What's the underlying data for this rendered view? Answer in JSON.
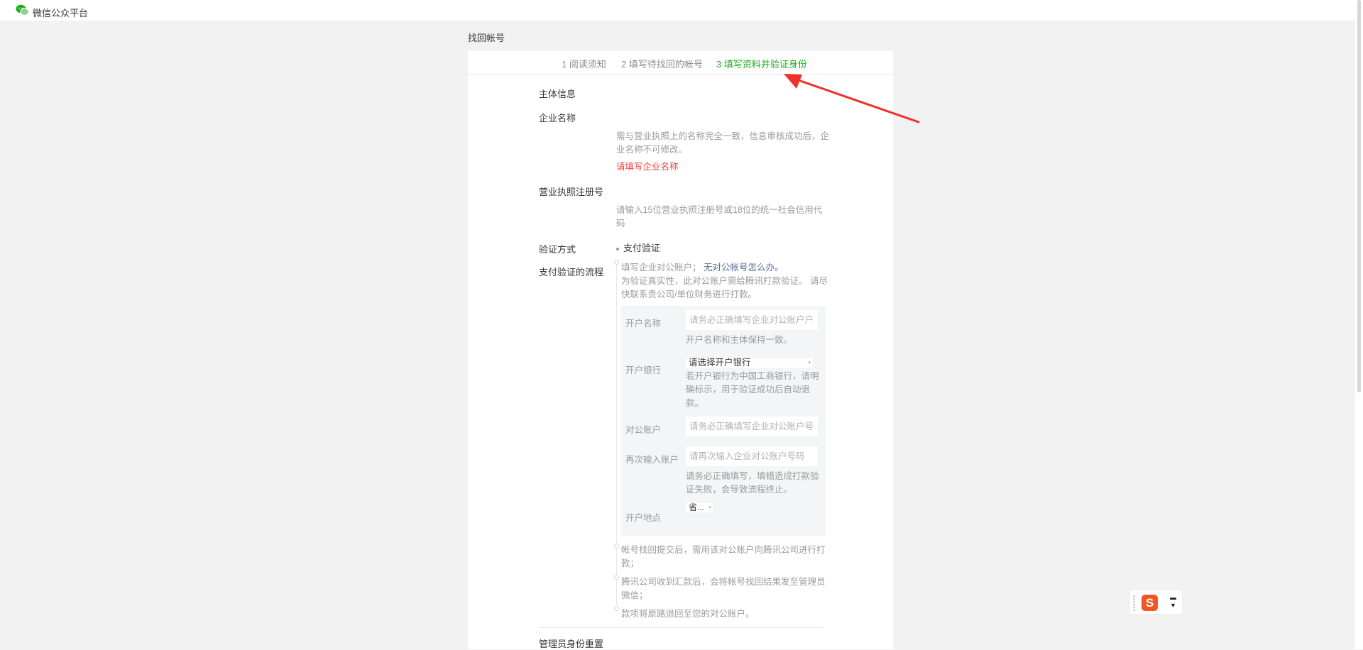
{
  "app": {
    "brand": "微信公众平台"
  },
  "page": {
    "title": "找回帐号"
  },
  "steps": [
    {
      "label": "1 阅读须知",
      "active": false
    },
    {
      "label": "2 填写待找回的帐号",
      "active": false
    },
    {
      "label": "3 填写资料并验证身份",
      "active": true
    }
  ],
  "form": {
    "section_title": "主体信息",
    "company_name": {
      "label": "企业名称",
      "help_line1": "需与营业执照上的名称完全一致，信息审核成功后，企",
      "help_line2": "业名称不可修改。",
      "error": "请填写企业名称"
    },
    "license": {
      "label": "营业执照注册号",
      "help_line1": "请输入15位营业执照注册号或18位的统一社会信用代",
      "help_line2": "码"
    },
    "verify_method": {
      "label": "验证方式",
      "option": "支付验证"
    },
    "flow": {
      "label": "支付验证的流程",
      "step1_text": "填写企业对公账户；",
      "step1_link": "无对公帐号怎么办。",
      "step1_desc_line1": "为验证真实性，此对公账户需给腾讯打款验证。 请尽",
      "step1_desc_line2": "快联系贵公司/单位财务进行打款。",
      "step2_line1": "帐号找回提交后，需用该对公账户向腾讯公司进行打",
      "step2_line2": "款；",
      "step3_line1": "腾讯公司收到汇款后，会将帐号找回结果发至管理员",
      "step3_line2": "微信；",
      "step4": "款项将原路退回至您的对公账户。"
    },
    "bank": {
      "account_name": {
        "label": "开户名称",
        "placeholder": "请务必正确填写企业对公账户户名",
        "help": "开户名称和主体保持一致。"
      },
      "bank": {
        "label": "开户银行",
        "selected": "请选择开户银行",
        "help_line1": "若开户银行为中国工商银行，请明",
        "help_line2": "确标示，用于验证成功后自动退",
        "help_line3": "款。"
      },
      "account": {
        "label": "对公账户",
        "placeholder": "请务必正确填写企业对公账户号码"
      },
      "account_confirm": {
        "label": "再次输入账户",
        "placeholder": "请再次输入企业对公账户号码",
        "help_line1": "请务必正确填写，填错造成打款验",
        "help_line2": "证失败，会导致流程终止。"
      },
      "location": {
        "label": "开户地点",
        "selected": "省..."
      }
    },
    "next_section_title": "管理员身份重置"
  },
  "colors": {
    "accent_green": "#1aad19",
    "error_red": "#e64340",
    "link_blue": "#576b95",
    "arrow_red": "#f0312a"
  }
}
